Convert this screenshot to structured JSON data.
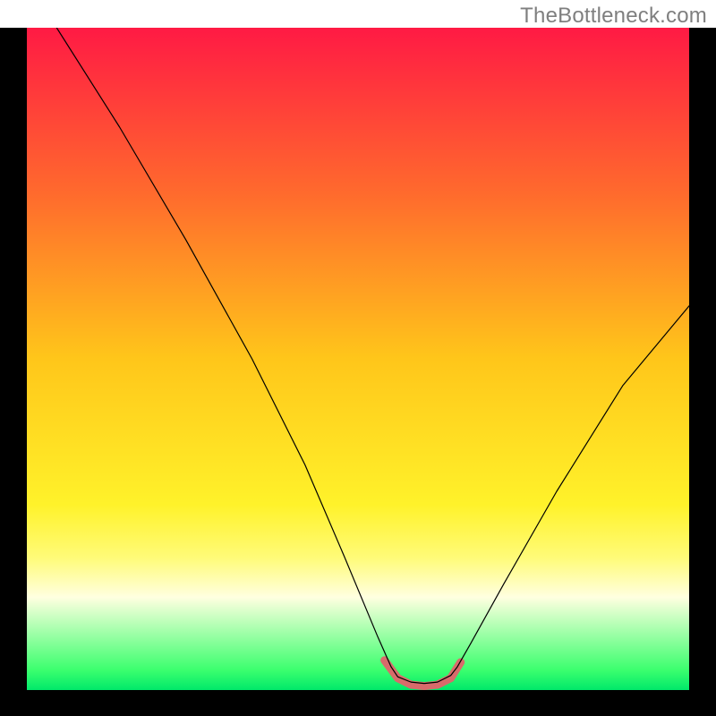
{
  "watermark": "TheBottleneck.com",
  "chart_data": {
    "type": "line",
    "title": "",
    "xlabel": "",
    "ylabel": "",
    "xlim": [
      0,
      100
    ],
    "ylim": [
      0,
      100
    ],
    "grid": false,
    "legend": false,
    "background_gradient": {
      "stops": [
        {
          "offset": 0.0,
          "color": "#ff1a44"
        },
        {
          "offset": 0.25,
          "color": "#ff6a2d"
        },
        {
          "offset": 0.5,
          "color": "#ffc61a"
        },
        {
          "offset": 0.72,
          "color": "#fff22a"
        },
        {
          "offset": 0.8,
          "color": "#fffb78"
        },
        {
          "offset": 0.86,
          "color": "#ffffe0"
        },
        {
          "offset": 0.97,
          "color": "#3bff6e"
        },
        {
          "offset": 1.0,
          "color": "#00e86a"
        }
      ]
    },
    "series": [
      {
        "name": "curve",
        "color": "#000000",
        "stroke_width": 1.2,
        "points": [
          {
            "x": 4.5,
            "y": 100.0
          },
          {
            "x": 14.0,
            "y": 85.0
          },
          {
            "x": 24.0,
            "y": 68.0
          },
          {
            "x": 34.0,
            "y": 50.0
          },
          {
            "x": 42.0,
            "y": 34.0
          },
          {
            "x": 48.0,
            "y": 20.0
          },
          {
            "x": 53.0,
            "y": 8.0
          },
          {
            "x": 55.0,
            "y": 3.5
          },
          {
            "x": 56.0,
            "y": 2.0
          },
          {
            "x": 58.0,
            "y": 1.2
          },
          {
            "x": 60.0,
            "y": 1.0
          },
          {
            "x": 62.0,
            "y": 1.2
          },
          {
            "x": 64.0,
            "y": 2.2
          },
          {
            "x": 65.0,
            "y": 3.5
          },
          {
            "x": 67.0,
            "y": 7.0
          },
          {
            "x": 72.0,
            "y": 16.0
          },
          {
            "x": 80.0,
            "y": 30.0
          },
          {
            "x": 90.0,
            "y": 46.0
          },
          {
            "x": 100.0,
            "y": 58.0
          }
        ]
      },
      {
        "name": "bottom-accent",
        "color": "#d86b6b",
        "stroke_width": 9,
        "points": [
          {
            "x": 54.0,
            "y": 4.5
          },
          {
            "x": 56.0,
            "y": 1.8
          },
          {
            "x": 58.0,
            "y": 0.8
          },
          {
            "x": 60.0,
            "y": 0.6
          },
          {
            "x": 62.0,
            "y": 0.8
          },
          {
            "x": 64.0,
            "y": 1.8
          },
          {
            "x": 65.5,
            "y": 4.2
          }
        ]
      }
    ]
  }
}
